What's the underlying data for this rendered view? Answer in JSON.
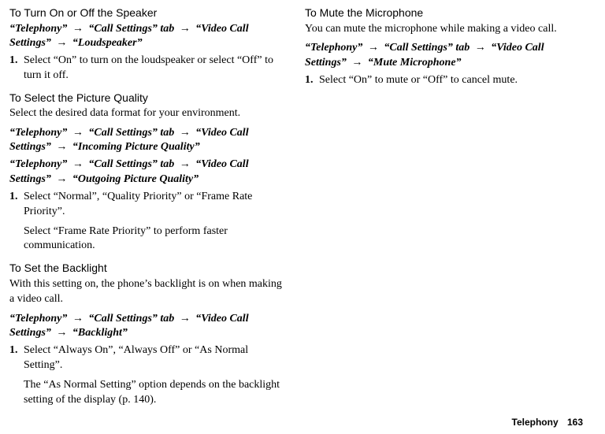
{
  "arrow": "→",
  "left": {
    "sec1": {
      "title": "To Turn On or Off the Speaker",
      "path_parts": [
        "“Telephony”",
        "“Call Settings” tab",
        "“Video Call Settings”",
        "“Loudspeaker”"
      ],
      "step_num": "1.",
      "step_text": "Select “On” to turn on the loudspeaker or select “Off” to turn it off."
    },
    "sec2": {
      "title": "To Select the Picture Quality",
      "intro": "Select the desired data format for your environment.",
      "path1_parts": [
        "“Telephony”",
        "“Call Settings” tab",
        "“Video Call Settings”",
        "“Incoming Picture Quality”"
      ],
      "path2_parts": [
        "“Telephony”",
        "“Call Settings” tab",
        "“Video Call Settings”",
        "“Outgoing Picture Quality”"
      ],
      "step_num": "1.",
      "step_text": "Select “Normal”, “Quality Priority” or “Frame Rate Priority”.",
      "step_sub": "Select “Frame Rate Priority” to perform faster communication."
    },
    "sec3": {
      "title": "To Set the Backlight",
      "intro": "With this setting on, the phone’s backlight is on when making a video call.",
      "path_parts": [
        "“Telephony”",
        "“Call Settings” tab",
        "“Video Call Settings”",
        "“Backlight”"
      ],
      "step_num": "1.",
      "step_text": "Select “Always On”, “Always Off” or “As Normal Setting”.",
      "step_sub": "The “As Normal Setting” option depends on the backlight setting of the display (p. 140)."
    }
  },
  "right": {
    "sec1": {
      "title": "To Mute the Microphone",
      "intro": "You can mute the microphone while making a video call.",
      "path_parts": [
        "“Telephony”",
        "“Call Settings” tab",
        "“Video Call Settings”",
        "“Mute Microphone”"
      ],
      "step_num": "1.",
      "step_text": "Select “On” to mute or “Off” to cancel mute."
    }
  },
  "footer": {
    "label": "Telephony",
    "page": "163"
  }
}
